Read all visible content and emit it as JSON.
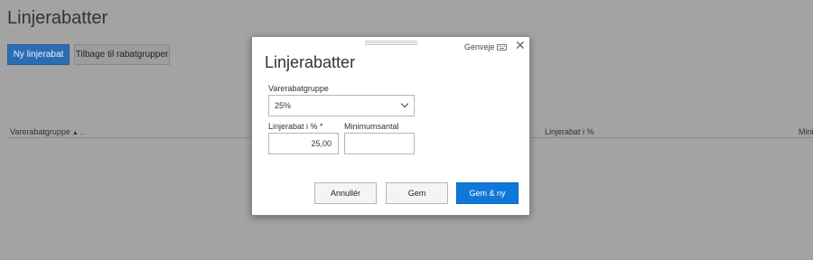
{
  "page": {
    "title": "Linjerabatter",
    "new_button": "Ny linjerabat",
    "back_button": "Tilbage til rabatgrupper",
    "columns": [
      "Varerabatgruppe",
      "Linjerabat i %",
      "Mini"
    ],
    "sort_indicator": "▲ ..."
  },
  "dialog": {
    "shortcut_label": "Genveje",
    "title": "Linjerabatter",
    "group_label": "Varerabatgruppe",
    "group_value": "25%",
    "pct_label": "Linjerabat i % *",
    "pct_value": "25,00",
    "min_label": "Minimumsantal",
    "min_value": "",
    "cancel_label": "Annullér",
    "save_label": "Gem",
    "save_new_label": "Gem & ny"
  },
  "colors": {
    "overlay": "#a3a3a3",
    "primary": "#0f78d9"
  }
}
